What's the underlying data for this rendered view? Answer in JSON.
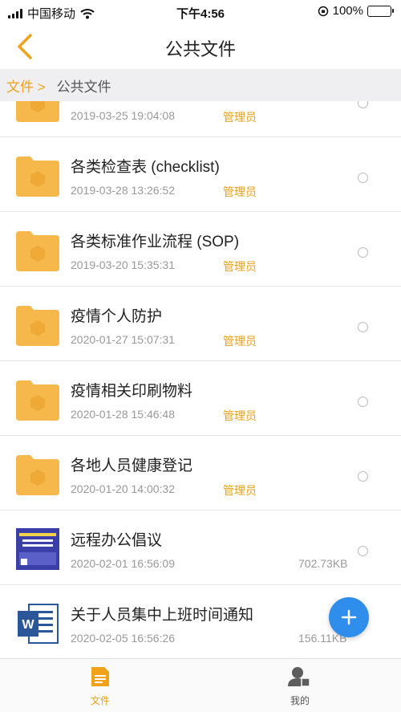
{
  "status_bar": {
    "carrier": "中国移动",
    "time": "下午4:56",
    "battery_percent": "100%",
    "battery_level": 1.0
  },
  "nav": {
    "title": "公共文件",
    "back_icon": "chevron-left-icon"
  },
  "breadcrumb": {
    "root": "文件 >",
    "current": "公共文件"
  },
  "files": [
    {
      "name": "",
      "date": "2019-03-25 19:04:08",
      "owner": "管理员",
      "size": "",
      "type": "folder"
    },
    {
      "name": "各类检查表 (checklist)",
      "date": "2019-03-28 13:26:52",
      "owner": "管理员",
      "size": "",
      "type": "folder"
    },
    {
      "name": "各类标准作业流程 (SOP)",
      "date": "2019-03-20 15:35:31",
      "owner": "管理员",
      "size": "",
      "type": "folder"
    },
    {
      "name": "疫情个人防护",
      "date": "2020-01-27 15:07:31",
      "owner": "管理员",
      "size": "",
      "type": "folder"
    },
    {
      "name": "疫情相关印刷物料",
      "date": "2020-01-28 15:46:48",
      "owner": "管理员",
      "size": "",
      "type": "folder"
    },
    {
      "name": "各地人员健康登记",
      "date": "2020-01-20 14:00:32",
      "owner": "管理员",
      "size": "",
      "type": "folder"
    },
    {
      "name": "远程办公倡议",
      "date": "2020-02-01 16:56:09",
      "owner": "",
      "size": "702.73KB",
      "type": "image"
    },
    {
      "name": "关于人员集中上班时间通知",
      "date": "2020-02-05 16:56:26",
      "owner": "",
      "size": "156.11KB",
      "type": "word"
    }
  ],
  "tabs": [
    {
      "label": "文件",
      "icon": "document-icon",
      "active": true
    },
    {
      "label": "我的",
      "icon": "user-icon",
      "active": false
    }
  ],
  "fab": {
    "icon": "plus-icon"
  },
  "colors": {
    "accent": "#f0a21b",
    "folder": "#f7b84b",
    "fab": "#2f8dec",
    "breadcrumb_bg": "#efeff1"
  }
}
